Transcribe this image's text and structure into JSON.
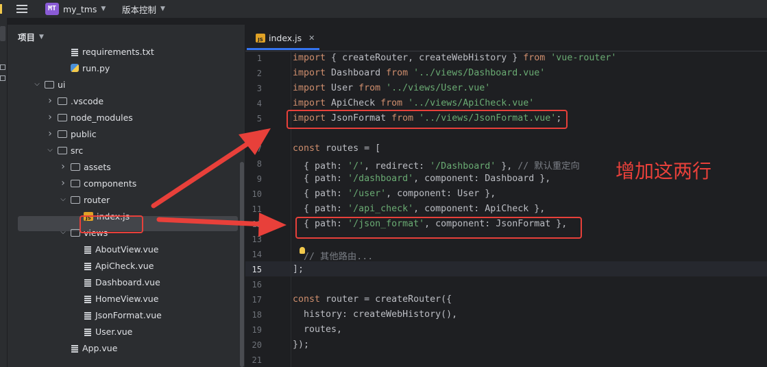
{
  "topbar": {
    "project_badge": "MT",
    "project_name": "my_tms",
    "vcs_label": "版本控制"
  },
  "sidebar": {
    "header": "项目",
    "tree": [
      {
        "label": "requirements.txt",
        "kind": "txt",
        "depth": 3
      },
      {
        "label": "run.py",
        "kind": "py",
        "depth": 3
      },
      {
        "label": "ui",
        "kind": "folder-open",
        "depth": 1
      },
      {
        "label": ".vscode",
        "kind": "folder-closed",
        "depth": 2
      },
      {
        "label": "node_modules",
        "kind": "folder-closed",
        "depth": 2
      },
      {
        "label": "public",
        "kind": "folder-closed",
        "depth": 2
      },
      {
        "label": "src",
        "kind": "folder-open",
        "depth": 2
      },
      {
        "label": "assets",
        "kind": "folder-closed",
        "depth": 3
      },
      {
        "label": "components",
        "kind": "folder-closed",
        "depth": 3
      },
      {
        "label": "router",
        "kind": "folder-open",
        "depth": 3
      },
      {
        "label": "index.js",
        "kind": "js",
        "depth": 4,
        "selected": true
      },
      {
        "label": "views",
        "kind": "folder-open",
        "depth": 3
      },
      {
        "label": "AboutView.vue",
        "kind": "txt",
        "depth": 4
      },
      {
        "label": "ApiCheck.vue",
        "kind": "txt",
        "depth": 4
      },
      {
        "label": "Dashboard.vue",
        "kind": "txt",
        "depth": 4
      },
      {
        "label": "HomeView.vue",
        "kind": "txt",
        "depth": 4
      },
      {
        "label": "JsonFormat.vue",
        "kind": "txt",
        "depth": 4
      },
      {
        "label": "User.vue",
        "kind": "txt",
        "depth": 4
      },
      {
        "label": "App.vue",
        "kind": "txt",
        "depth": 3
      }
    ]
  },
  "editor": {
    "tab_label": "index.js",
    "tab_icon_text": "JS",
    "current_line": "15",
    "lines": [
      {
        "n": "1",
        "tokens": [
          [
            "kw",
            "import"
          ],
          [
            "plain",
            " { createRouter, createWebHistory } "
          ],
          [
            "kw",
            "from"
          ],
          [
            "plain",
            " "
          ],
          [
            "str",
            "'vue-router'"
          ]
        ]
      },
      {
        "n": "2",
        "tokens": [
          [
            "kw",
            "import"
          ],
          [
            "plain",
            " Dashboard "
          ],
          [
            "kw",
            "from"
          ],
          [
            "plain",
            " "
          ],
          [
            "str",
            "'../views/Dashboard.vue'"
          ]
        ]
      },
      {
        "n": "3",
        "tokens": [
          [
            "kw",
            "import"
          ],
          [
            "plain",
            " User "
          ],
          [
            "kw",
            "from"
          ],
          [
            "plain",
            " "
          ],
          [
            "str",
            "'../views/User.vue'"
          ]
        ]
      },
      {
        "n": "4",
        "tokens": [
          [
            "kw",
            "import"
          ],
          [
            "plain",
            " ApiCheck "
          ],
          [
            "kw",
            "from"
          ],
          [
            "plain",
            " "
          ],
          [
            "str",
            "'../views/ApiCheck.vue'"
          ]
        ]
      },
      {
        "n": "5",
        "tokens": [
          [
            "kw",
            "import"
          ],
          [
            "plain",
            " JsonFormat "
          ],
          [
            "kw",
            "from"
          ],
          [
            "plain",
            " "
          ],
          [
            "str",
            "'../views/JsonFormat.vue'"
          ],
          [
            "plain",
            ";"
          ]
        ]
      },
      {
        "n": "6",
        "tokens": []
      },
      {
        "n": "7",
        "tokens": [
          [
            "kw",
            "const"
          ],
          [
            "plain",
            " routes = ["
          ]
        ]
      },
      {
        "n": "8",
        "tokens": [
          [
            "plain",
            "  { path: "
          ],
          [
            "str",
            "'/'"
          ],
          [
            "plain",
            ", redirect: "
          ],
          [
            "str",
            "'/Dashboard'"
          ],
          [
            "plain",
            " }, "
          ],
          [
            "cmt",
            "// 默认重定向"
          ]
        ]
      },
      {
        "n": "9",
        "tokens": [
          [
            "plain",
            "  { path: "
          ],
          [
            "str",
            "'/dashboard'"
          ],
          [
            "plain",
            ", component: Dashboard },"
          ]
        ]
      },
      {
        "n": "10",
        "tokens": [
          [
            "plain",
            "  { path: "
          ],
          [
            "str",
            "'/user'"
          ],
          [
            "plain",
            ", component: User },"
          ]
        ]
      },
      {
        "n": "11",
        "tokens": [
          [
            "plain",
            "  { path: "
          ],
          [
            "str",
            "'/api_check'"
          ],
          [
            "plain",
            ", component: ApiCheck },"
          ]
        ]
      },
      {
        "n": "12",
        "tokens": [
          [
            "plain",
            "  { path: "
          ],
          [
            "str",
            "'/json_format'"
          ],
          [
            "plain",
            ", component: JsonFormat },"
          ]
        ]
      },
      {
        "n": "13",
        "tokens": []
      },
      {
        "n": "14",
        "tokens": [
          [
            "cmt",
            "  // 其他路由..."
          ]
        ]
      },
      {
        "n": "15",
        "tokens": [
          [
            "plain",
            "];"
          ]
        ]
      },
      {
        "n": "16",
        "tokens": []
      },
      {
        "n": "17",
        "tokens": [
          [
            "kw",
            "const"
          ],
          [
            "plain",
            " router = createRouter({"
          ]
        ]
      },
      {
        "n": "18",
        "tokens": [
          [
            "plain",
            "  history: createWebHistory(),"
          ]
        ]
      },
      {
        "n": "19",
        "tokens": [
          [
            "plain",
            "  routes,"
          ]
        ]
      },
      {
        "n": "20",
        "tokens": [
          [
            "plain",
            "});"
          ]
        ]
      },
      {
        "n": "21",
        "tokens": []
      }
    ]
  },
  "annotation": {
    "text": "增加这两行",
    "color": "#e8403a"
  },
  "colors": {
    "keyword": "#cf8e6d",
    "string": "#6aab73",
    "comment": "#7a7e85",
    "accent": "#3574f0"
  }
}
